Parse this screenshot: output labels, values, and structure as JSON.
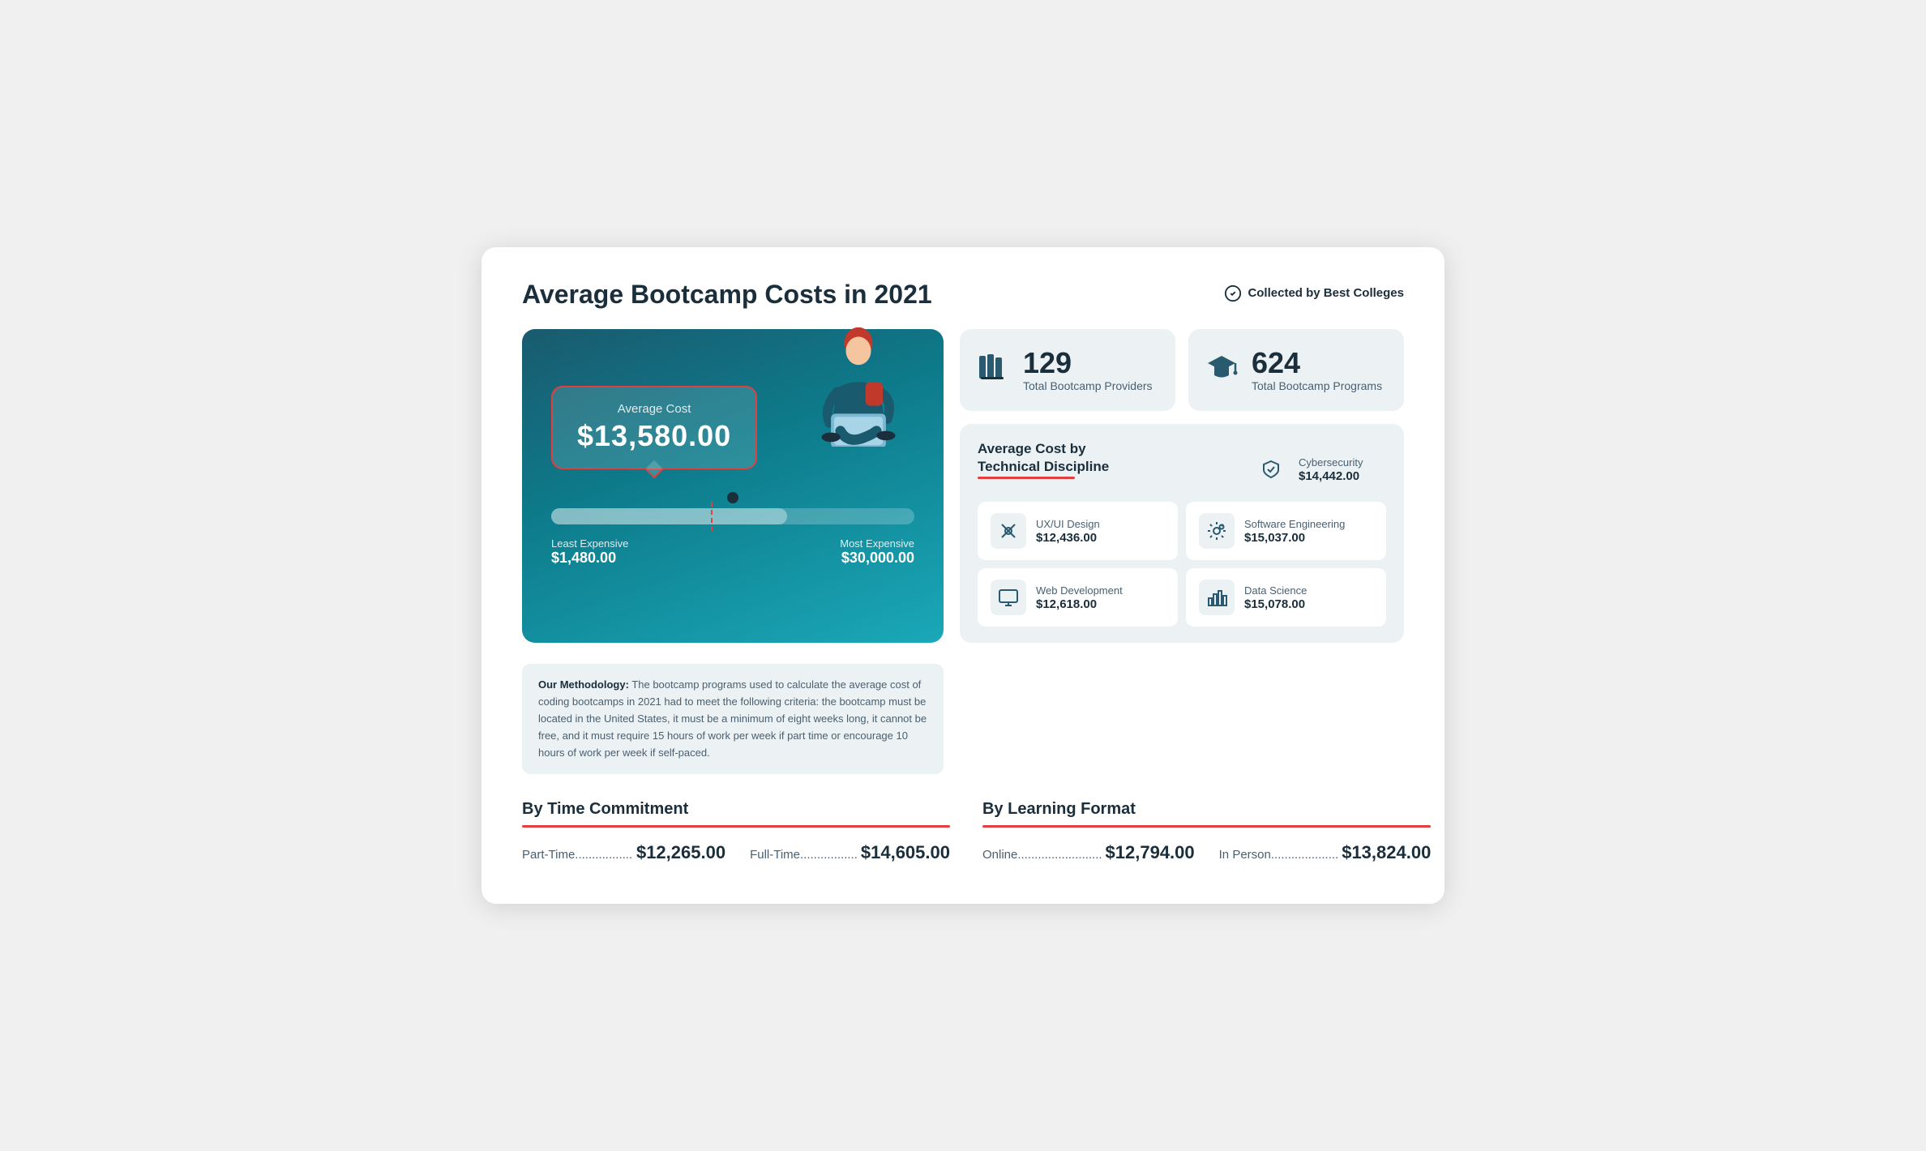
{
  "header": {
    "title": "Average Bootcamp Costs in 2021",
    "collected_by": "Collected by Best Colleges"
  },
  "gauge": {
    "avg_label": "Average Cost",
    "avg_value": "$13,580.00",
    "least_label": "Least Expensive",
    "least_value": "$1,480.00",
    "most_label": "Most Expensive",
    "most_value": "$30,000.00"
  },
  "stats": {
    "providers": {
      "number": "129",
      "label": "Total Bootcamp Providers"
    },
    "programs": {
      "number": "624",
      "label": "Total Bootcamp Programs"
    }
  },
  "discipline": {
    "title": "Average Cost by Technical Discipline",
    "items": [
      {
        "name": "Cybersecurity",
        "price": "$14,442.00",
        "icon": "shield"
      },
      {
        "name": "UX/UI Design",
        "price": "$12,436.00",
        "icon": "design"
      },
      {
        "name": "Software Engineering",
        "price": "$15,037.00",
        "icon": "gear"
      },
      {
        "name": "Web Development",
        "price": "$12,618.00",
        "icon": "monitor"
      },
      {
        "name": "Data Science",
        "price": "$15,078.00",
        "icon": "chart"
      }
    ]
  },
  "methodology": {
    "bold": "Our Methodology:",
    "text": " The bootcamp programs used to calculate the average cost of coding bootcamps in 2021 had to meet the following criteria: the bootcamp must be located in the United States, it must be a minimum of eight weeks long, it cannot be free, and it must require 15 hours of work per week if part time or encourage 10 hours of work per week if self-paced."
  },
  "time_commitment": {
    "title": "By Time Commitment",
    "items": [
      {
        "label": "Part-Time",
        "price": "$12,265.00"
      },
      {
        "label": "Full-Time",
        "price": "$14,605.00"
      }
    ]
  },
  "learning_format": {
    "title": "By Learning Format",
    "items": [
      {
        "label": "Online",
        "price": "$12,794.00"
      },
      {
        "label": "In Person",
        "price": "$13,824.00"
      }
    ]
  }
}
